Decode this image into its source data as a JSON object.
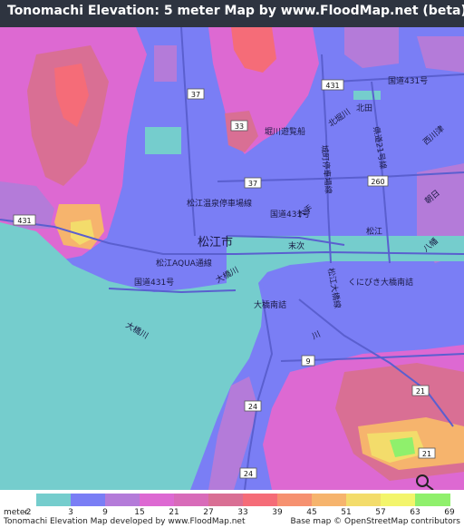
{
  "title": "Tonomachi Elevation: 5 meter Map by www.FloodMap.net (beta)",
  "map": {
    "labels": {
      "city_matsue": "松江市",
      "road_431_east": "国道431号",
      "road_431_center": "国道431号",
      "road_431_south": "国道431号",
      "station_line": "松江温泉停車場線",
      "kunibiki": "くにびき大橋南詰",
      "ohashi_minamizume": "大橋南詰",
      "ohashigawa": "大橋川",
      "ohashigawa_west": "大橋川",
      "matsue_ohashi_line": "松江大橋線",
      "matsue_aqua": "松江AQUA通線",
      "horikawa": "堀川遊覧船",
      "kita_horikawa": "北堀川",
      "nishikawatsu": "西川津",
      "kitada": "北田",
      "ken_road_21": "県道21号線",
      "tsumadani_line": "城町停車場線",
      "asahi": "朝日",
      "yachiyo": "八幡",
      "kumano": "松江",
      "daikai": "大手",
      "suetsugu": "末次",
      "river_kita": "川"
    },
    "shields": {
      "r431_w": "431",
      "r431_ne": "431",
      "r37_n": "37",
      "r37_c": "37",
      "r33": "33",
      "r260": "260",
      "r9": "9",
      "r24_a": "24",
      "r24_b": "24",
      "r21_a": "21",
      "r21_b": "21"
    }
  },
  "legend": {
    "unit": "meter",
    "items": [
      {
        "label": "-2",
        "color": "#75cdcd"
      },
      {
        "label": "3",
        "color": "#7a7ef5"
      },
      {
        "label": "9",
        "color": "#b47bd9"
      },
      {
        "label": "15",
        "color": "#dd69d2"
      },
      {
        "label": "21",
        "color": "#d86bb9"
      },
      {
        "label": "27",
        "color": "#d96f94"
      },
      {
        "label": "33",
        "color": "#f56c78"
      },
      {
        "label": "39",
        "color": "#f69170"
      },
      {
        "label": "45",
        "color": "#f6b46d"
      },
      {
        "label": "51",
        "color": "#f3dc6b"
      },
      {
        "label": "57",
        "color": "#f3f56c"
      },
      {
        "label": "63",
        "color": "#8ff06c"
      },
      {
        "label": "69",
        "color": "#7dd86c"
      }
    ]
  },
  "footer": {
    "left": "Tonomachi Elevation Map developed by www.FloodMap.net",
    "right": "Base map © OpenStreetMap contributors"
  }
}
